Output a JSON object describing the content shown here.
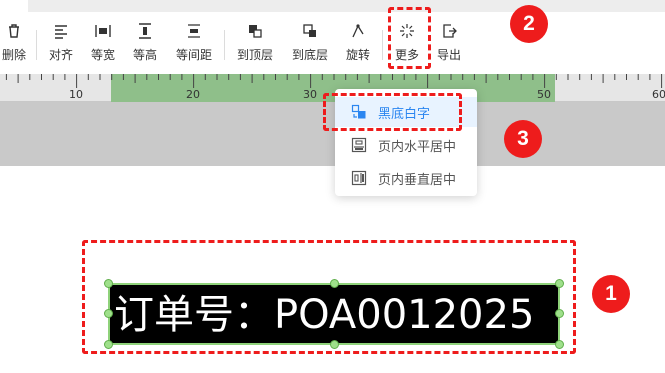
{
  "toolbar": {
    "items": [
      {
        "label": "删除",
        "icon": "trash-icon"
      },
      {
        "label": "对齐",
        "icon": "align-left-icon"
      },
      {
        "label": "等宽",
        "icon": "equal-width-icon"
      },
      {
        "label": "等高",
        "icon": "equal-height-icon"
      },
      {
        "label": "等间距",
        "icon": "equal-spacing-icon"
      },
      {
        "label": "到顶层",
        "icon": "bring-to-front-icon"
      },
      {
        "label": "到底层",
        "icon": "send-to-back-icon"
      },
      {
        "label": "旋转",
        "icon": "rotate-icon"
      },
      {
        "label": "更多",
        "icon": "more-sparkle-icon"
      },
      {
        "label": "导出",
        "icon": "export-icon"
      }
    ]
  },
  "ruler": {
    "labels": [
      "10",
      "20",
      "30",
      "40",
      "50",
      "60"
    ],
    "highlight_color": "#8fbf8a"
  },
  "dropdown": {
    "items": [
      {
        "label": "黑底白字",
        "icon": "invert-color-icon",
        "active": true
      },
      {
        "label": "页内水平居中",
        "icon": "center-horizontal-icon",
        "active": false
      },
      {
        "label": "页内垂直居中",
        "icon": "center-vertical-icon",
        "active": false
      }
    ]
  },
  "canvas": {
    "text_element": "订单号：POA0012025",
    "background": "#000000",
    "text_color": "#ffffff"
  },
  "annotations": {
    "badges": [
      "1",
      "2",
      "3"
    ],
    "color": "#ee1c1c"
  }
}
